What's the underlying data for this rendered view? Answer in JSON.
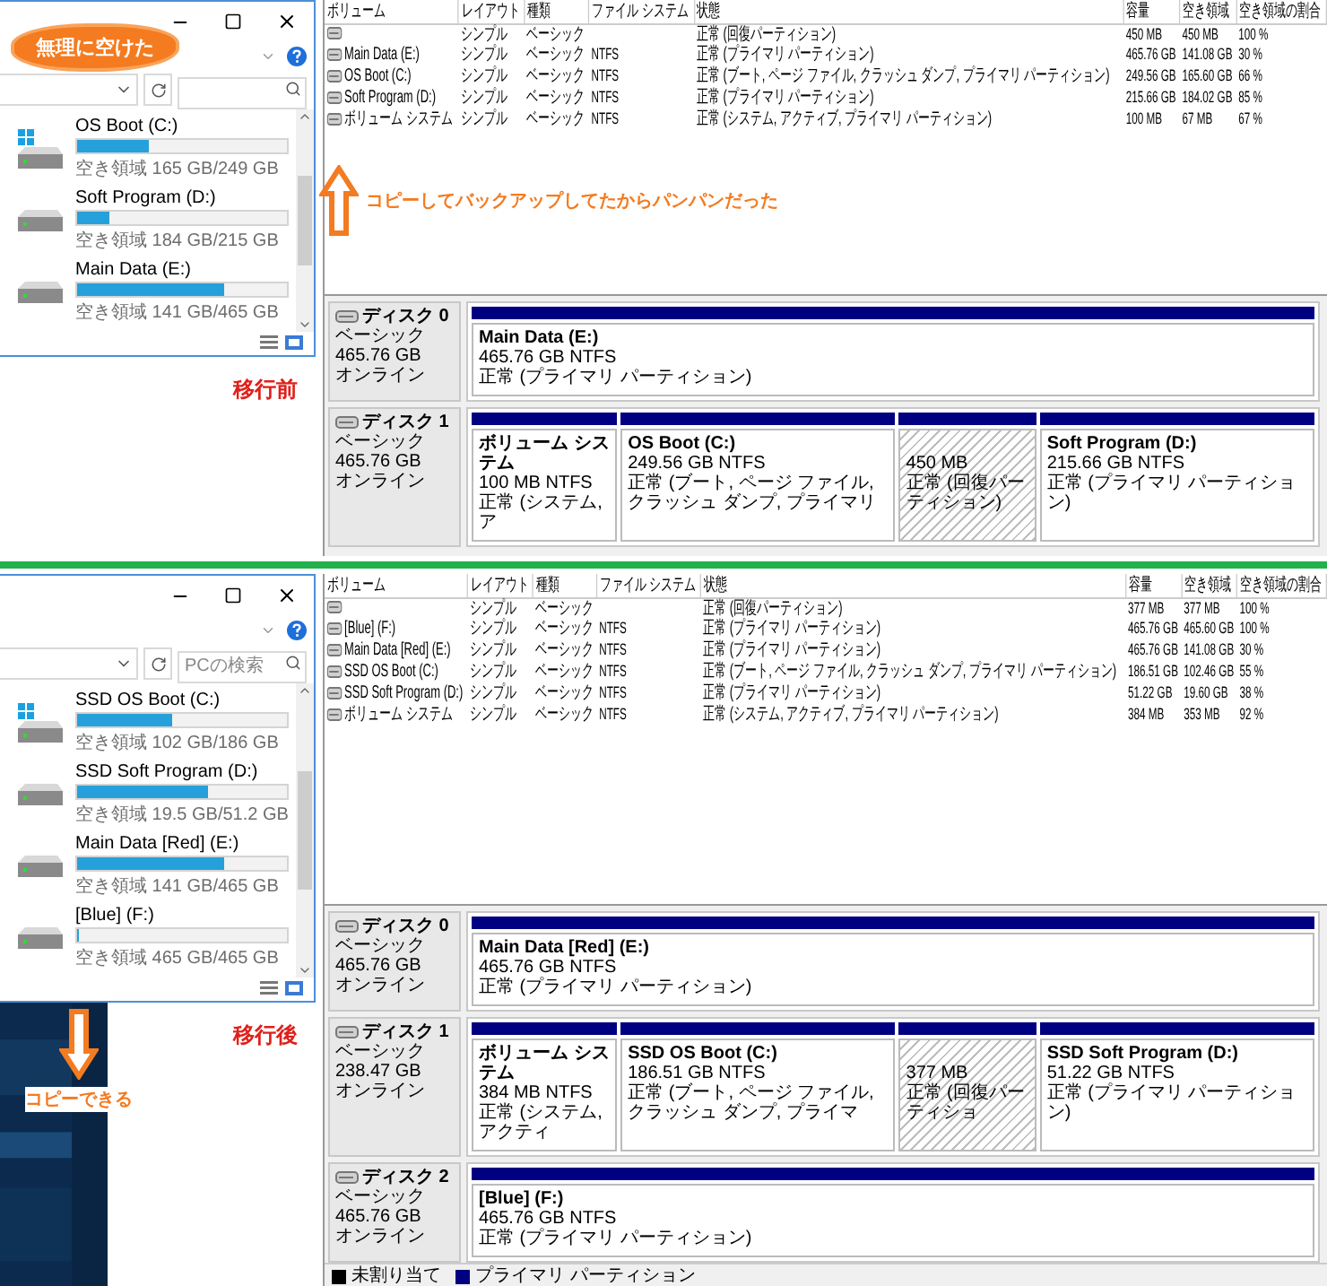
{
  "panels": [
    {
      "caption": "移行前",
      "explorer": {
        "drives": [
          {
            "name": "OS Boot (C:)",
            "free": "空き領域 165 GB/249 GB",
            "level": 0.34,
            "os": true
          },
          {
            "name": "Soft Program (D:)",
            "free": "空き領域 184 GB/215 GB",
            "level": 0.15,
            "os": false
          },
          {
            "name": "Main Data (E:)",
            "free": "空き領域 141 GB/465 GB",
            "level": 0.7,
            "os": false
          }
        ]
      },
      "annotations": [
        {
          "kind": "cloud",
          "text": "無理に空けた"
        },
        {
          "kind": "upnote",
          "text": "コピーしてバックアップしてたからパンパンだった"
        }
      ],
      "disk_management": {
        "columns": [
          "ボリューム",
          "レイアウト",
          "種類",
          "ファイル システム",
          "状態",
          "容量",
          "空き領域",
          "空き領域の割合"
        ],
        "rows": [
          {
            "layout": "シンプル",
            "type": "ベーシック",
            "status": "正常 (回復パーティション)",
            "capacity": "450 MB",
            "free": "450 MB",
            "percent": "100 %"
          },
          {
            "volume": "Main Data (E:)",
            "layout": "シンプル",
            "type": "ベーシック",
            "fs": "NTFS",
            "status": "正常 (プライマリ パーティション)",
            "capacity": "465.76 GB",
            "free": "141.08 GB",
            "percent": "30 %"
          },
          {
            "volume": "OS Boot (C:)",
            "layout": "シンプル",
            "type": "ベーシック",
            "fs": "NTFS",
            "status": "正常 (ブート, ページ ファイル, クラッシュ ダンプ, プライマリ パーティション)",
            "capacity": "249.56 GB",
            "free": "165.60 GB",
            "percent": "66 %"
          },
          {
            "volume": "Soft Program (D:)",
            "layout": "シンプル",
            "type": "ベーシック",
            "fs": "NTFS",
            "status": "正常 (プライマリ パーティション)",
            "capacity": "215.66 GB",
            "free": "184.02 GB",
            "percent": "85 %"
          },
          {
            "volume": "ボリューム システム",
            "layout": "シンプル",
            "type": "ベーシック",
            "fs": "NTFS",
            "status": "正常 (システム, アクティブ, プライマリ パーティション)",
            "capacity": "100 MB",
            "free": "67 MB",
            "percent": "67 %"
          }
        ],
        "disks": [
          {
            "label": "ディスク 0",
            "type": "ベーシック",
            "size": "465.76 GB",
            "state": "オンライン",
            "partitions": [
              {
                "kind": "primary",
                "name": "Main Data  (E:)",
                "size": "465.76 GB NTFS",
                "status": "正常 (プライマリ パーティション)"
              }
            ]
          },
          {
            "label": "ディスク 1",
            "type": "ベーシック",
            "size": "465.76 GB",
            "state": "オンライン",
            "partitions": [
              {
                "kind": "system",
                "name": "ボリューム システム",
                "size": "100 MB NTFS",
                "status": "正常 (システム, ア"
              },
              {
                "kind": "primary",
                "name": "OS Boot  (C:)",
                "size": "249.56 GB NTFS",
                "status": "正常 (ブート, ページ ファイル, クラッシュ ダンプ, プライマリ"
              },
              {
                "kind": "recovery",
                "size": "450 MB",
                "status": "正常 (回復パーティション)"
              },
              {
                "kind": "primary",
                "name": "Soft Program  (D:)",
                "size": "215.66 GB NTFS",
                "status": "正常 (プライマリ パーティション)"
              }
            ]
          }
        ]
      }
    },
    {
      "caption": "移行後",
      "explorer": {
        "search_placeholder": "PCの検索",
        "drives": [
          {
            "name": "SSD OS Boot (C:)",
            "free": "空き領域 102 GB/186 GB",
            "level": 0.45,
            "os": true
          },
          {
            "name": "SSD Soft Program (D:)",
            "free": "空き領域 19.5 GB/51.2 GB",
            "level": 0.62,
            "os": false
          },
          {
            "name": "Main Data [Red] (E:)",
            "free": "空き領域 141 GB/465 GB",
            "level": 0.7,
            "os": false
          },
          {
            "name": "[Blue] (F:)",
            "free": "空き領域 465 GB/465 GB",
            "level": 0,
            "os": false
          }
        ]
      },
      "desktop": {
        "kind": "picture"
      },
      "annotations": [
        {
          "kind": "downnote",
          "text": "コピーできる"
        }
      ],
      "disk_management": {
        "columns": [
          "ボリューム",
          "レイアウト",
          "種類",
          "ファイル システム",
          "状態",
          "容量",
          "空き領域",
          "空き領域の割合"
        ],
        "rows": [
          {
            "layout": "シンプル",
            "type": "ベーシック",
            "status": "正常 (回復パーティション)",
            "capacity": "377 MB",
            "free": "377 MB",
            "percent": "100 %"
          },
          {
            "volume": "[Blue] (F:)",
            "layout": "シンプル",
            "type": "ベーシック",
            "fs": "NTFS",
            "status": "正常 (プライマリ パーティション)",
            "capacity": "465.76 GB",
            "free": "465.60 GB",
            "percent": "100 %"
          },
          {
            "volume": "Main Data [Red] (E:)",
            "layout": "シンプル",
            "type": "ベーシック",
            "fs": "NTFS",
            "status": "正常 (プライマリ パーティション)",
            "capacity": "465.76 GB",
            "free": "141.08 GB",
            "percent": "30 %"
          },
          {
            "volume": "SSD OS Boot (C:)",
            "layout": "シンプル",
            "type": "ベーシック",
            "fs": "NTFS",
            "status": "正常 (ブート, ページ ファイル, クラッシュ ダンプ, プライマリ パーティション)",
            "capacity": "186.51 GB",
            "free": "102.46 GB",
            "percent": "55 %"
          },
          {
            "volume": "SSD Soft Program (D:)",
            "layout": "シンプル",
            "type": "ベーシック",
            "fs": "NTFS",
            "status": "正常 (プライマリ パーティション)",
            "capacity": "51.22 GB",
            "free": "19.60 GB",
            "percent": "38 %"
          },
          {
            "volume": "ボリューム システム",
            "layout": "シンプル",
            "type": "ベーシック",
            "fs": "NTFS",
            "status": "正常 (システム, アクティブ, プライマリ パーティション)",
            "capacity": "384 MB",
            "free": "353 MB",
            "percent": "92 %"
          }
        ],
        "disks": [
          {
            "label": "ディスク 0",
            "type": "ベーシック",
            "size": "465.76 GB",
            "state": "オンライン",
            "partitions": [
              {
                "kind": "primary",
                "name": "Main Data [Red]  (E:)",
                "size": "465.76 GB NTFS",
                "status": "正常 (プライマリ パーティション)"
              }
            ]
          },
          {
            "label": "ディスク 1",
            "type": "ベーシック",
            "size": "238.47 GB",
            "state": "オンライン",
            "partitions": [
              {
                "kind": "system",
                "name": "ボリューム システム",
                "size": "384 MB NTFS",
                "status": "正常 (システム, アクティ"
              },
              {
                "kind": "primary",
                "name": "SSD OS Boot  (C:)",
                "size": "186.51 GB NTFS",
                "status": "正常 (ブート, ページ ファイル, クラッシュ ダンプ, プライマ"
              },
              {
                "kind": "recovery",
                "size": "377 MB",
                "status": "正常 (回復パーティショ"
              },
              {
                "kind": "primary",
                "name": "SSD Soft Program  (D:)",
                "size": "51.22 GB NTFS",
                "status": "正常 (プライマリ パーティション)"
              }
            ]
          },
          {
            "label": "ディスク 2",
            "type": "ベーシック",
            "size": "465.76 GB",
            "state": "オンライン",
            "partitions": [
              {
                "kind": "primary",
                "name": "[Blue]  (F:)",
                "size": "465.76 GB NTFS",
                "status": "正常 (プライマリ パーティション)"
              }
            ]
          }
        ],
        "legend": [
          {
            "label": "未割り当て",
            "color": "#000000"
          },
          {
            "label": "プライマリ パーティション",
            "color": "#000080"
          }
        ]
      }
    }
  ]
}
